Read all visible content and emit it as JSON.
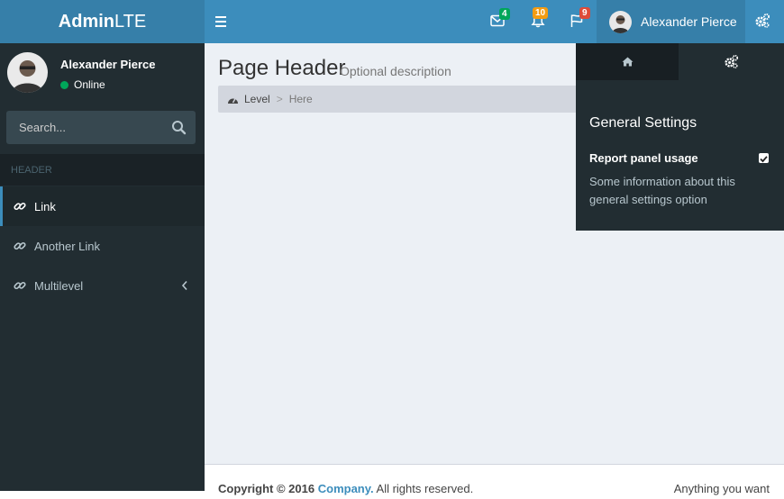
{
  "brand": {
    "bold": "Admin",
    "light": "LTE"
  },
  "navbar": {
    "messages_count": "4",
    "notifications_count": "10",
    "tasks_count": "9",
    "user_name": "Alexander Pierce"
  },
  "sidebar": {
    "user": {
      "name": "Alexander Pierce",
      "status": "Online"
    },
    "search_placeholder": "Search...",
    "header": "HEADER",
    "items": [
      {
        "label": "Link",
        "active": true
      },
      {
        "label": "Another Link",
        "active": false
      },
      {
        "label": "Multilevel",
        "active": false
      }
    ]
  },
  "content": {
    "title": "Page Header",
    "description": "Optional description",
    "breadcrumb": {
      "level": "Level",
      "separator": ">",
      "here": "Here"
    }
  },
  "control_sidebar": {
    "title": "General Settings",
    "option_label": "Report panel usage",
    "option_checked": true,
    "option_info": "Some information about this general settings option"
  },
  "footer": {
    "copyright": "Copyright © 2016",
    "company": "Company.",
    "rights": "All rights reserved.",
    "right_text": "Anything you want"
  },
  "colors": {
    "primary": "#3c8dbc",
    "primary_dark": "#367fa9",
    "sidebar_bg": "#222d32",
    "success": "#00a65a",
    "warning": "#f39c12",
    "danger": "#dd4b39"
  }
}
